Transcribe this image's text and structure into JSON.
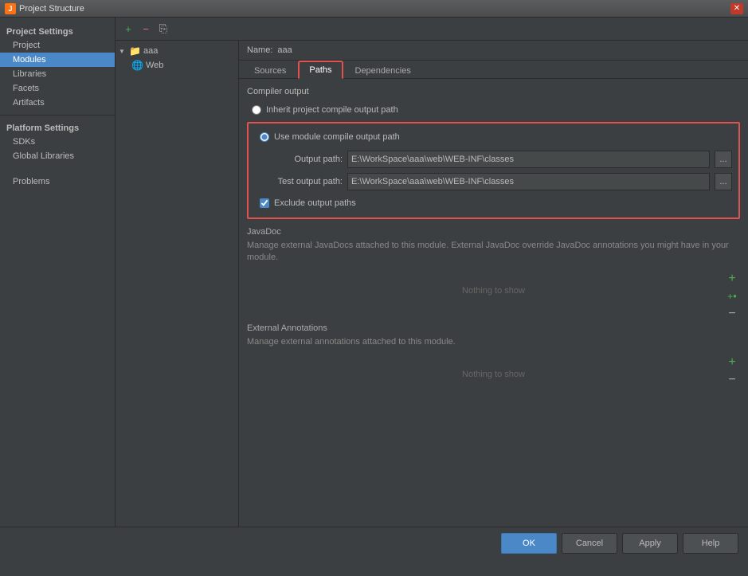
{
  "titleBar": {
    "icon": "J",
    "title": "Project Structure",
    "closeLabel": "✕"
  },
  "leftToolbar": {
    "addLabel": "+",
    "removeLabel": "−",
    "copyLabel": "⎘"
  },
  "tree": {
    "rootLabel": "aaa",
    "rootArrow": "▼",
    "childLabel": "Web",
    "childIcon": "🌐"
  },
  "sidebar": {
    "projectSettingsTitle": "Project Settings",
    "items": [
      {
        "id": "project",
        "label": "Project"
      },
      {
        "id": "modules",
        "label": "Modules"
      },
      {
        "id": "libraries",
        "label": "Libraries"
      },
      {
        "id": "facets",
        "label": "Facets"
      },
      {
        "id": "artifacts",
        "label": "Artifacts"
      }
    ],
    "platformSettingsTitle": "Platform Settings",
    "platformItems": [
      {
        "id": "sdks",
        "label": "SDKs"
      },
      {
        "id": "global-libraries",
        "label": "Global Libraries"
      }
    ],
    "problemsLabel": "Problems"
  },
  "nameRow": {
    "label": "Name:",
    "value": "aaa"
  },
  "tabs": [
    {
      "id": "sources",
      "label": "Sources"
    },
    {
      "id": "paths",
      "label": "Paths"
    },
    {
      "id": "dependencies",
      "label": "Dependencies"
    }
  ],
  "activeTab": "paths",
  "paths": {
    "compilerOutputTitle": "Compiler output",
    "inheritRadioLabel": "Inherit project compile output path",
    "useModuleRadioLabel": "Use module compile output path",
    "outputPathLabel": "Output path:",
    "outputPathValue": "E:\\WorkSpace\\aaa\\web\\WEB-INF\\classes",
    "testOutputPathLabel": "Test output path:",
    "testOutputPathValue": "E:\\WorkSpace\\aaa\\web\\WEB-INF\\classes",
    "excludeCheckboxLabel": "Exclude output paths",
    "browseLabel": "..."
  },
  "javadoc": {
    "title": "JavaDoc",
    "description": "Manage external JavaDocs attached to this module. External JavaDoc override JavaDoc annotations you might have in your module.",
    "emptyLabel": "Nothing to show"
  },
  "externalAnnotations": {
    "title": "External Annotations",
    "description": "Manage external annotations attached to this module.",
    "emptyLabel": "Nothing to show"
  },
  "bottomBar": {
    "okLabel": "OK",
    "cancelLabel": "Cancel",
    "applyLabel": "Apply",
    "helpLabel": "Help"
  }
}
